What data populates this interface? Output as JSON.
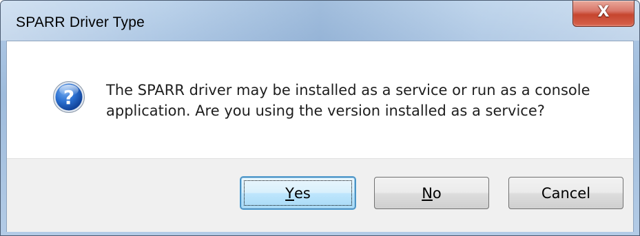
{
  "window": {
    "title": "SPARR Driver Type",
    "close_glyph": "X"
  },
  "dialog": {
    "icon": "question-icon",
    "message_line1": "The SPARR driver may be installed as a service or run as a console",
    "message_line2": "application.  Are you using the version installed as a service?"
  },
  "buttons": {
    "yes": {
      "accel": "Y",
      "rest": "es"
    },
    "no": {
      "accel": "N",
      "rest": "o"
    },
    "cancel": "Cancel"
  },
  "colors": {
    "icon_blue": "#1e5db8",
    "close_red": "#c6452e",
    "focus_blue": "#3c7fb1"
  }
}
